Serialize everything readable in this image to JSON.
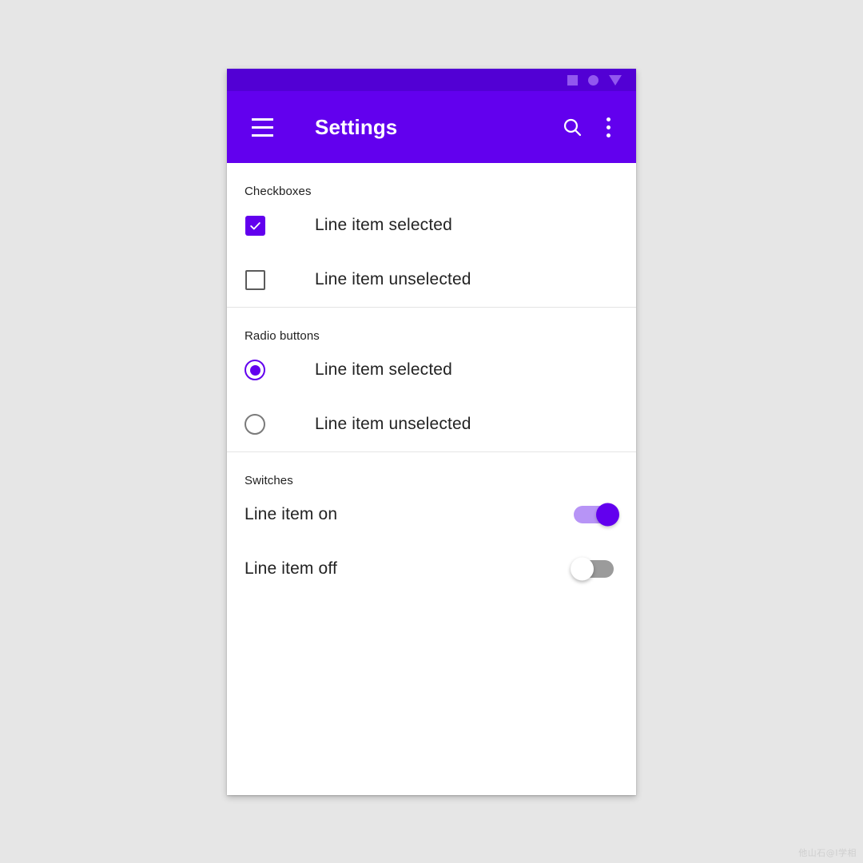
{
  "app": {
    "title": "Settings",
    "bar_color": "#6200ee",
    "status_bar_color": "#5200d4",
    "accent_color": "#6200ee",
    "background_color": "#e6e6e6",
    "menu_icon": "hamburger-menu-icon",
    "search_icon": "search-icon",
    "overflow_icon": "more-vertical-icon"
  },
  "status_bar": {
    "icons": [
      "square-icon",
      "circle-icon",
      "triangle-down-icon"
    ],
    "icon_color": "#9257ef"
  },
  "sections": [
    {
      "id": "checkboxes",
      "title": "Checkboxes",
      "rows": [
        {
          "label": "Line item selected",
          "control": "checkbox",
          "state": "checked"
        },
        {
          "label": "Line item unselected",
          "control": "checkbox",
          "state": "unchecked"
        }
      ]
    },
    {
      "id": "radios",
      "title": "Radio buttons",
      "rows": [
        {
          "label": "Line item selected",
          "control": "radio",
          "state": "selected"
        },
        {
          "label": "Line item unselected",
          "control": "radio",
          "state": "unselected"
        }
      ]
    },
    {
      "id": "switches",
      "title": "Switches",
      "rows": [
        {
          "label": "Line item on",
          "control": "switch",
          "state": "on"
        },
        {
          "label": "Line item off",
          "control": "switch",
          "state": "off"
        }
      ]
    }
  ],
  "watermark": "他山石@I学相"
}
